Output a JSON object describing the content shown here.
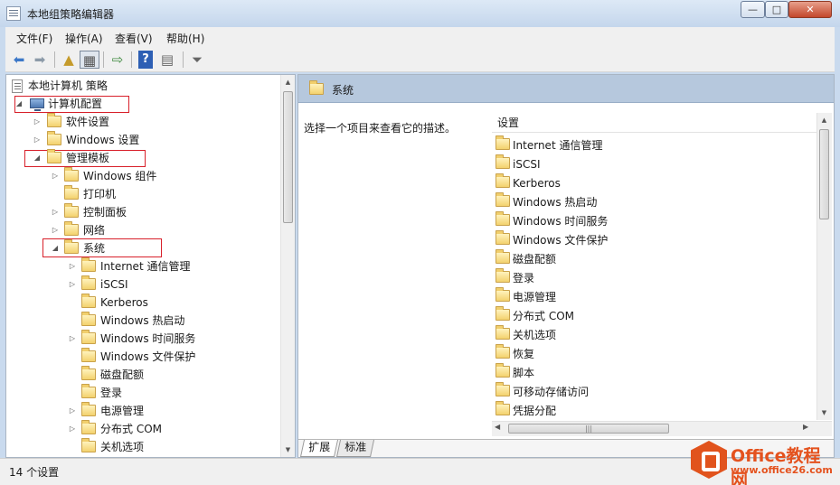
{
  "window": {
    "title": "本地组策略编辑器",
    "minimize": "—",
    "maximize": "□",
    "close": "✕"
  },
  "menu": [
    "文件(F)",
    "操作(A)",
    "查看(V)",
    "帮助(H)"
  ],
  "tree": {
    "root": "本地计算机 策略",
    "computer_config": "计算机配置",
    "software_settings": "软件设置",
    "windows_settings": "Windows 设置",
    "admin_templates": "管理模板",
    "windows_components": "Windows 组件",
    "printer": "打印机",
    "control_panel": "控制面板",
    "network": "网络",
    "system": "系统",
    "system_children": [
      "Internet 通信管理",
      "iSCSI",
      "Kerberos",
      "Windows 热启动",
      "Windows 时间服务",
      "Windows 文件保护",
      "磁盘配额",
      "登录",
      "电源管理",
      "分布式 COM",
      "关机选项"
    ]
  },
  "details": {
    "header_title": "系统",
    "description": "选择一个项目来查看它的描述。",
    "column_header": "设置",
    "items": [
      "Internet 通信管理",
      "iSCSI",
      "Kerberos",
      "Windows 热启动",
      "Windows 时间服务",
      "Windows 文件保护",
      "磁盘配额",
      "登录",
      "电源管理",
      "分布式 COM",
      "关机选项",
      "恢复",
      "脚本",
      "可移动存储访问",
      "凭据分配"
    ]
  },
  "tabs": [
    "扩展",
    "标准"
  ],
  "status": "14 个设置",
  "watermark": {
    "brand": "Office教程网",
    "url": "www.office26.com"
  },
  "icons": {
    "back": "back-arrow-icon",
    "forward": "forward-arrow-icon",
    "up": "up-folder-icon",
    "show_tree": "show-hide-tree-icon",
    "export": "export-list-icon",
    "help": "help-icon",
    "properties": "properties-icon",
    "filter": "filter-icon"
  },
  "colors": {
    "highlight_box": "#d8202a",
    "header_band": "#b6c8dd",
    "watermark": "#e4521e"
  }
}
